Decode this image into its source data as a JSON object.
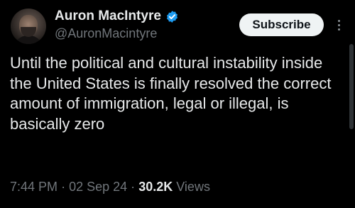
{
  "author": {
    "display_name": "Auron MacIntyre",
    "handle": "@AuronMacintyre",
    "verified": true,
    "avatar_icon": "profile-photo"
  },
  "actions": {
    "subscribe_label": "Subscribe",
    "more_icon": "vertical-ellipsis-icon"
  },
  "tweet": {
    "text": "Until the political and cultural instability inside the United States is finally resolved the correct amount of immigration, legal or illegal, is basically zero"
  },
  "meta": {
    "time": "7:44 PM",
    "separator": "·",
    "date": "02 Sep 24",
    "views_count": "30.2K",
    "views_label": "Views"
  },
  "colors": {
    "background": "#000000",
    "text": "#e7e9ea",
    "secondary": "#71767b",
    "verified": "#1d9bf0",
    "button_bg": "#eff3f4"
  }
}
